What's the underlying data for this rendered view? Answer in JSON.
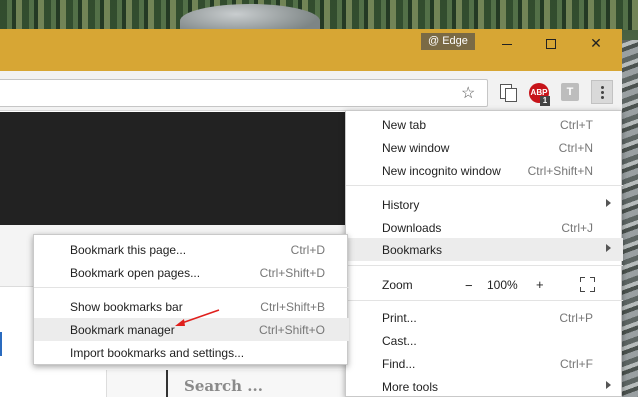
{
  "titlebar": {
    "profile_label": "@ Edge",
    "minimize_label": "",
    "maximize_label": "",
    "close_label": "✕"
  },
  "toolbar": {
    "bookmark_star": "☆",
    "abp_label": "ABP",
    "abp_count": "1",
    "ext_t_label": "T"
  },
  "page": {
    "search_placeholder": "Search ..."
  },
  "main_menu": {
    "items": [
      {
        "label": "New tab",
        "shortcut": "Ctrl+T"
      },
      {
        "label": "New window",
        "shortcut": "Ctrl+N"
      },
      {
        "label": "New incognito window",
        "shortcut": "Ctrl+Shift+N"
      },
      {
        "label": "History",
        "shortcut": ""
      },
      {
        "label": "Downloads",
        "shortcut": "Ctrl+J"
      },
      {
        "label": "Bookmarks",
        "shortcut": ""
      },
      {
        "label": "Zoom",
        "shortcut": ""
      },
      {
        "label": "Print...",
        "shortcut": "Ctrl+P"
      },
      {
        "label": "Cast...",
        "shortcut": ""
      },
      {
        "label": "Find...",
        "shortcut": "Ctrl+F"
      },
      {
        "label": "More tools",
        "shortcut": ""
      }
    ],
    "zoom": {
      "minus": "−",
      "value": "100%",
      "plus": "+"
    }
  },
  "bookmarks_menu": {
    "items": [
      {
        "label": "Bookmark this page...",
        "shortcut": "Ctrl+D"
      },
      {
        "label": "Bookmark open pages...",
        "shortcut": "Ctrl+Shift+D"
      },
      {
        "label": "Show bookmarks bar",
        "shortcut": "Ctrl+Shift+B"
      },
      {
        "label": "Bookmark manager",
        "shortcut": "Ctrl+Shift+O"
      },
      {
        "label": "Import bookmarks and settings...",
        "shortcut": ""
      }
    ]
  },
  "colors": {
    "titlebar": "#d7a634",
    "highlight": "#ececec",
    "annotation_arrow": "#e0201d"
  }
}
